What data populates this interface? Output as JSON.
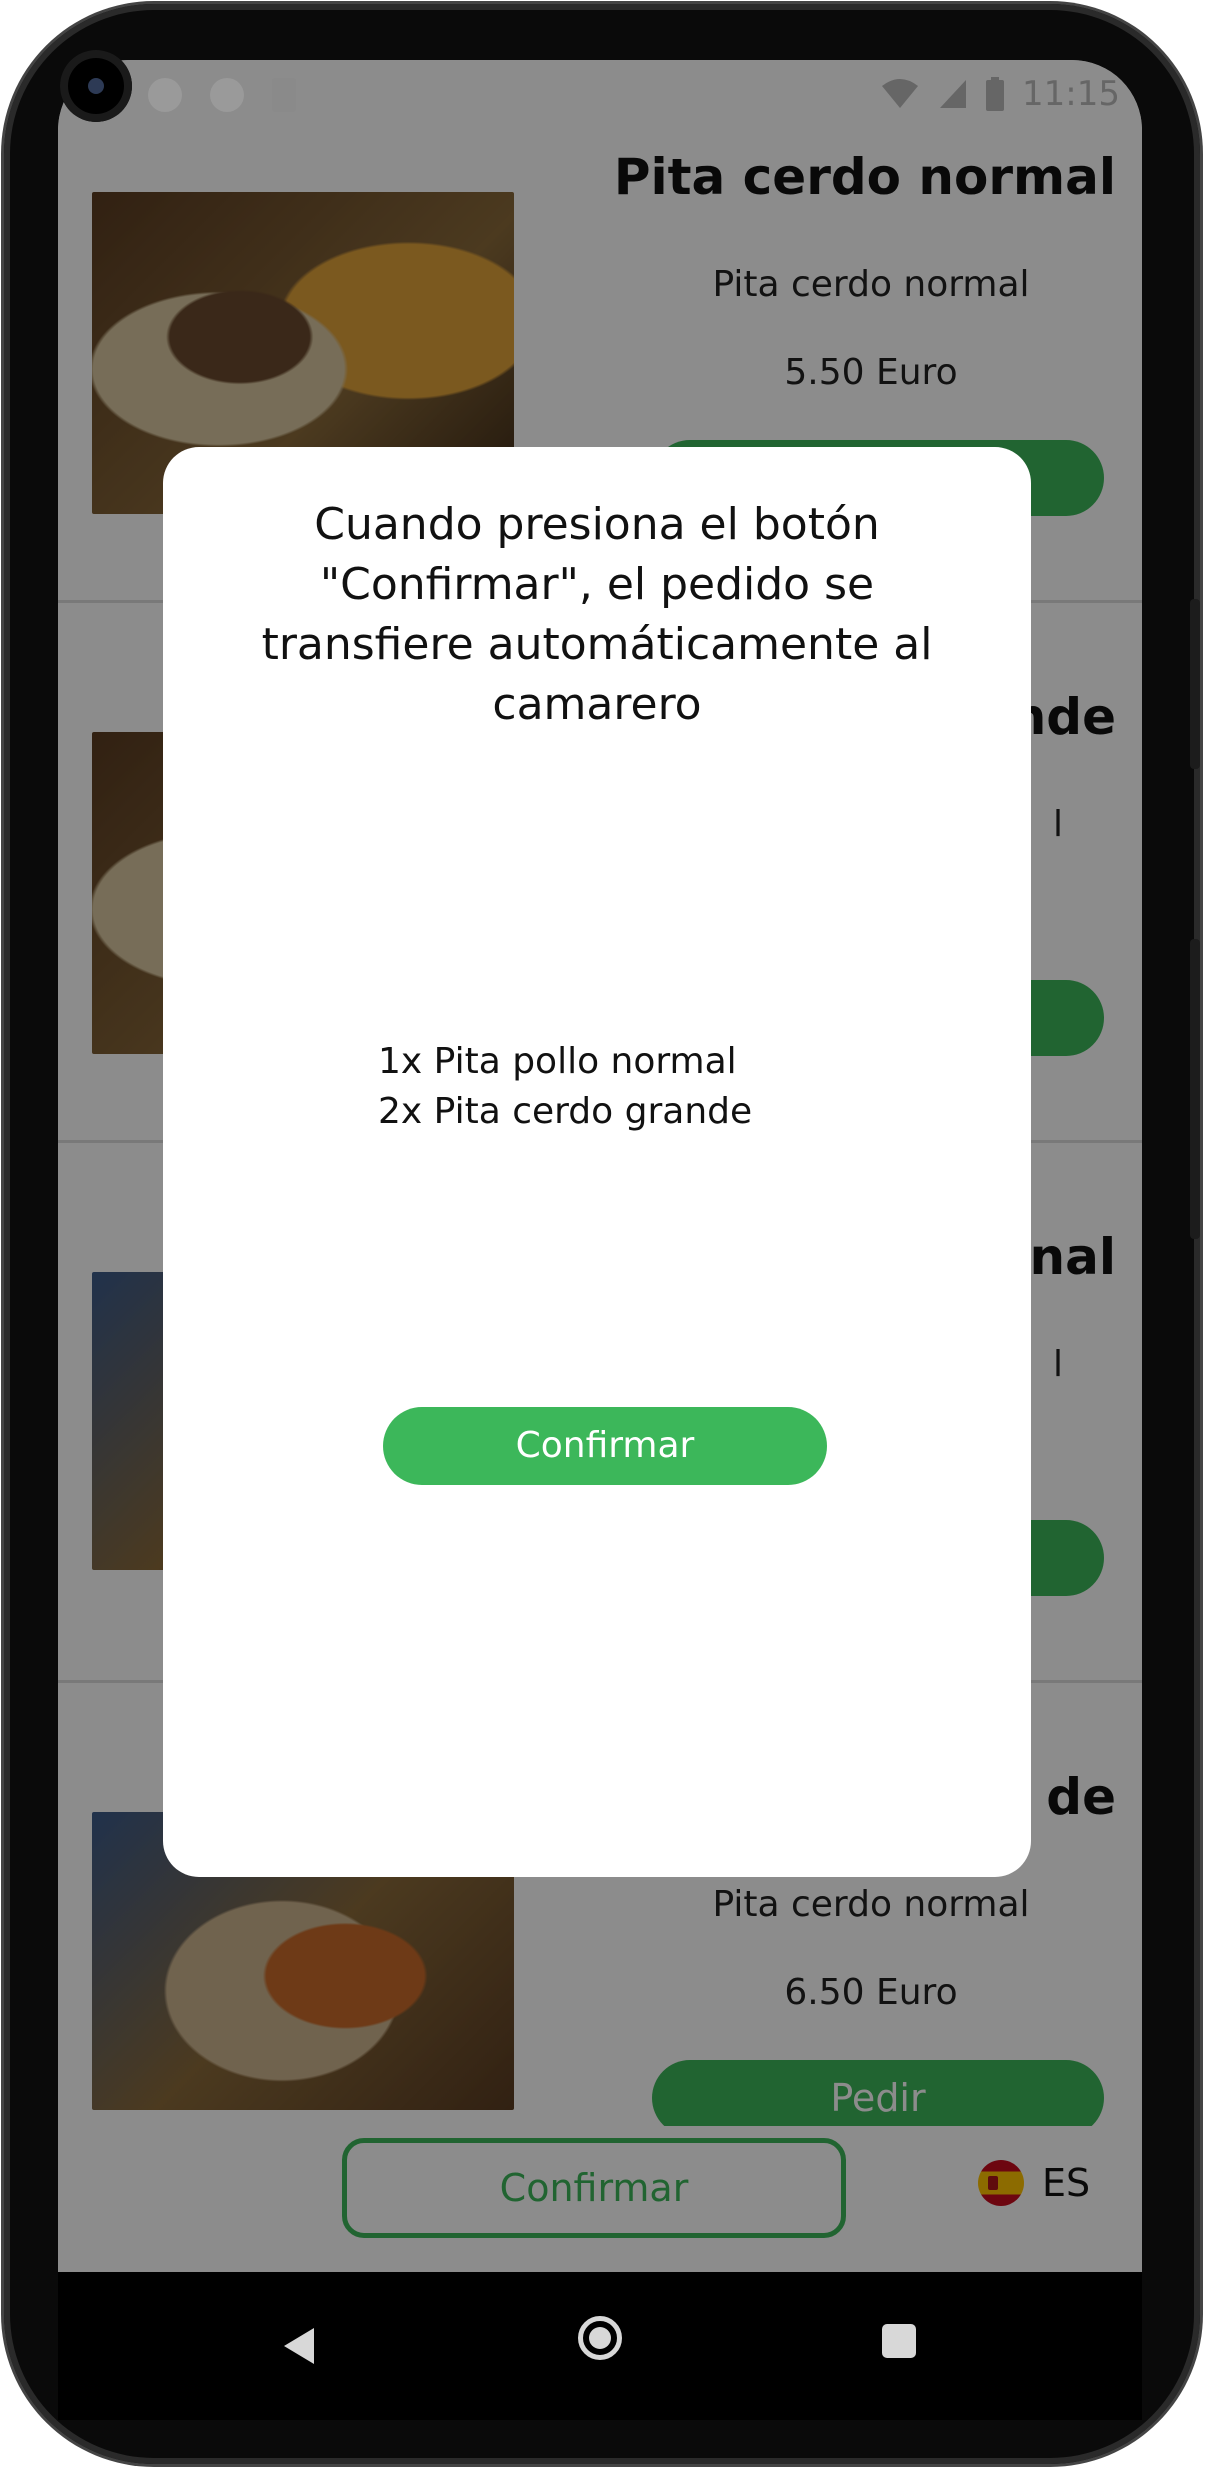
{
  "status_bar": {
    "time": "11:15"
  },
  "menu": {
    "items": [
      {
        "title": "Pita cerdo normal",
        "description": "Pita cerdo normal",
        "price": "5.50 Euro",
        "button": ""
      },
      {
        "title": "ande",
        "description": "l",
        "price": "",
        "button": ""
      },
      {
        "title": "nal",
        "description": "l",
        "price": "",
        "button": ""
      },
      {
        "title": "de",
        "description": "Pita cerdo normal",
        "price": "6.50 Euro",
        "button": "Pedir"
      }
    ]
  },
  "bottom_bar": {
    "confirm_label": "Confirmar",
    "language_code": "ES"
  },
  "dialog": {
    "message": "Cuando presiona el botón \"Confirmar\", el pedido se transfiere automáticamente al camarero",
    "order_lines": [
      "1x Pita pollo normal",
      "2x Pita cerdo grande"
    ],
    "confirm_label": "Confirmar"
  },
  "colors": {
    "accent_green": "#3cb75a"
  }
}
